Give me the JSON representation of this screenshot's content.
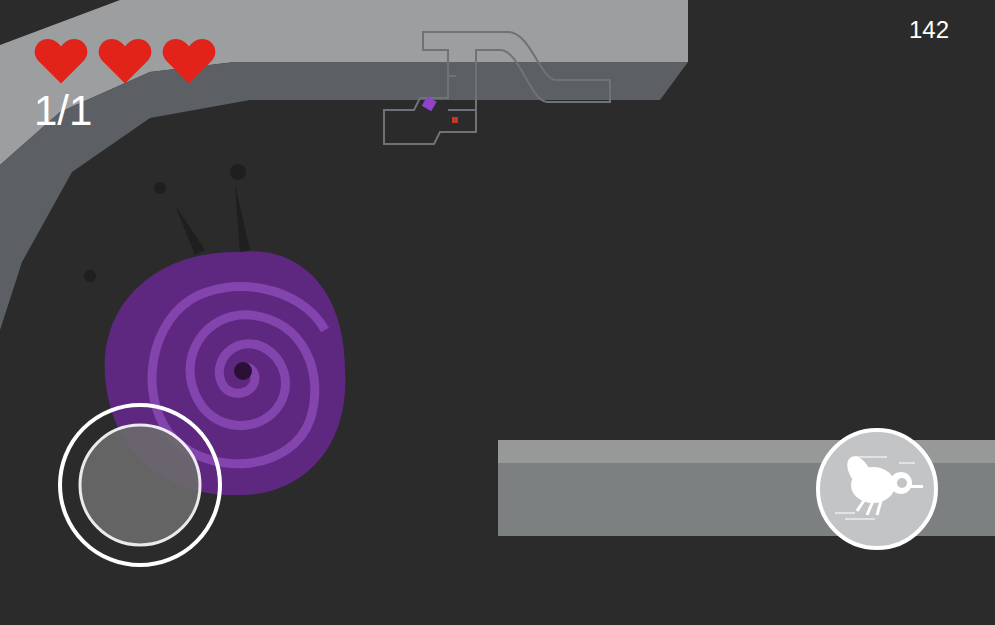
{
  "hud": {
    "hearts": [
      {
        "filled": true
      },
      {
        "filled": true
      },
      {
        "filled": true
      }
    ],
    "progress": "1/1",
    "score": "142"
  }
}
